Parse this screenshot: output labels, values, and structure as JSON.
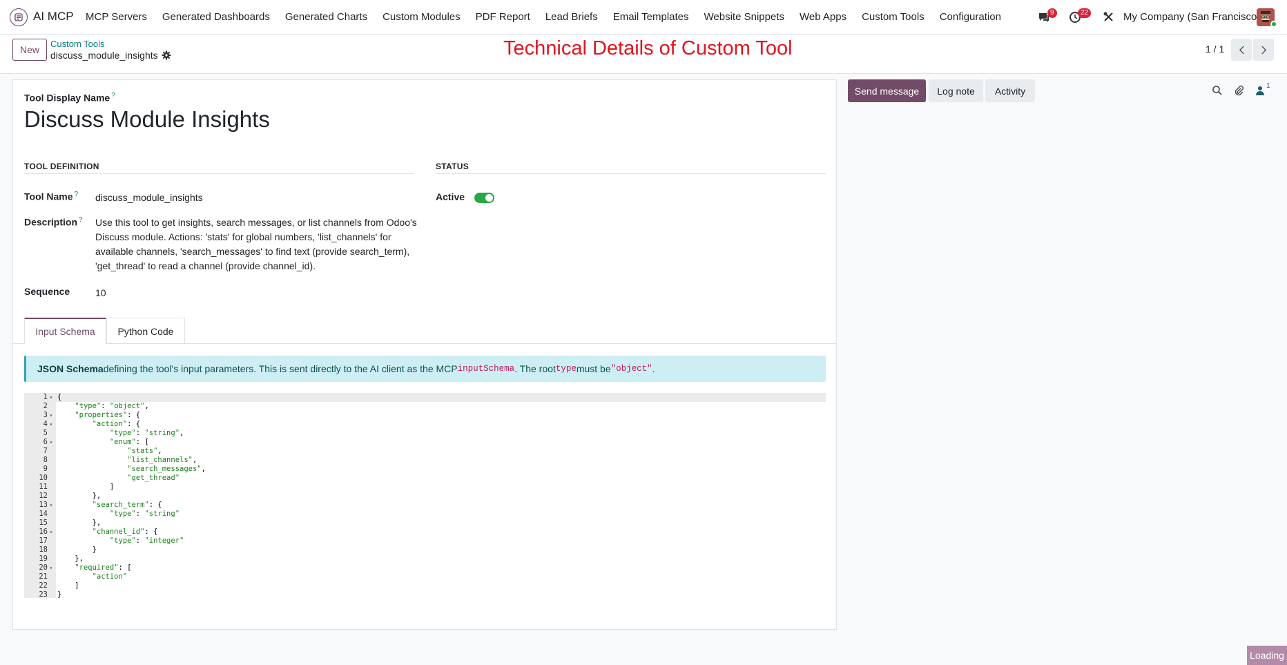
{
  "app": {
    "name": "AI MCP"
  },
  "menu": [
    "MCP Servers",
    "Generated Dashboards",
    "Generated Charts",
    "Custom Modules",
    "PDF Report",
    "Lead Briefs",
    "Email Templates",
    "Website Snippets",
    "Web Apps",
    "Custom Tools",
    "Configuration"
  ],
  "systray": {
    "messages_count": "9",
    "activities_count": "22",
    "company": "My Company (San Francisco)"
  },
  "control_panel": {
    "new_label": "New",
    "breadcrumb_parent": "Custom Tools",
    "breadcrumb_current": "discuss_module_insights",
    "heading": "Technical Details of Custom Tool",
    "pager": "1 / 1"
  },
  "form": {
    "display_name_label": "Tool Display Name",
    "display_name": "Discuss Module Insights",
    "tool_definition_heading": "TOOL DEFINITION",
    "status_heading": "STATUS",
    "tool_name_label": "Tool Name",
    "tool_name": "discuss_module_insights",
    "description_label": "Description",
    "description": "Use this tool to get insights, search messages, or list channels from Odoo's Discuss module. Actions: 'stats' for global numbers, 'list_channels' for available channels, 'search_messages' to find text (provide search_term), 'get_thread' to read a channel (provide channel_id).",
    "sequence_label": "Sequence",
    "sequence": "10",
    "active_label": "Active",
    "active": true
  },
  "tabs": [
    "Input Schema",
    "Python Code"
  ],
  "info": {
    "bold": "JSON Schema",
    "text1": " defining the tool's input parameters. This is sent directly to the AI client as the MCP ",
    "code1": "inputSchema",
    "text2": ". The root ",
    "code2": "type",
    "text3": " must be ",
    "code3": "\"object\"",
    "text4": "."
  },
  "code_lines": [
    "{",
    "    \"type\": \"object\",",
    "    \"properties\": {",
    "        \"action\": {",
    "            \"type\": \"string\",",
    "            \"enum\": [",
    "                \"stats\",",
    "                \"list_channels\",",
    "                \"search_messages\",",
    "                \"get_thread\"",
    "            ]",
    "        },",
    "        \"search_term\": {",
    "            \"type\": \"string\"",
    "        },",
    "        \"channel_id\": {",
    "            \"type\": \"integer\"",
    "        }",
    "    },",
    "    \"required\": [",
    "        \"action\"",
    "    ]",
    "}"
  ],
  "foldable_lines": [
    1,
    3,
    4,
    6,
    13,
    16,
    20
  ],
  "chatter": {
    "send_message": "Send message",
    "log_note": "Log note",
    "activity": "Activity",
    "followers_count": "1"
  },
  "loading_label": "Loading",
  "colors": {
    "brand": "#714b67",
    "accent": "#017e84",
    "heading": "#e0141e",
    "toggle_on": "#28a745"
  }
}
